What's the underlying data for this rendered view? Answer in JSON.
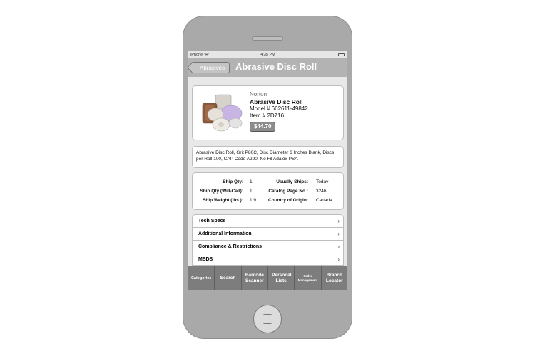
{
  "status_bar": {
    "carrier": "iPhone",
    "time": "4:35 PM"
  },
  "nav": {
    "back_label": "Abrasives",
    "title": "Abrasive Disc Roll"
  },
  "product": {
    "brand": "Norton",
    "name": "Abrasive Disc Roll",
    "model": "Model # 662611-49842",
    "item": "Item # 2D716",
    "price": "$44.70"
  },
  "description": "Abrasive Disc Roll, Grit P80C, Disc Diameter 6 Inches Blank, Discs per Roll 100, CAP Code A290, No Fil Adalox PSA",
  "shipping": {
    "rows": [
      {
        "label1": "Ship Qty:",
        "value1": "1",
        "label2": "Usually Ships:",
        "value2": "Today"
      },
      {
        "label1": "Ship Qty (Will-Call):",
        "value1": "1",
        "label2": "Catalog Page No.:",
        "value2": "3246"
      },
      {
        "label1": "Ship Weight (lbs.):",
        "value1": "1.9",
        "label2": "Country of Origin:",
        "value2": "Canada"
      }
    ]
  },
  "sections": [
    {
      "label": "Tech Specs"
    },
    {
      "label": "Additional Information"
    },
    {
      "label": "Compliance & Restrictions"
    },
    {
      "label": "MSDS"
    }
  ],
  "tabs": {
    "categories": "Categories",
    "search": "Search",
    "barcode_scanner": "Barcode Scanner",
    "personal_lists": "Personal Lists",
    "order_management": "Order Management",
    "branch_locator": "Branch Locator"
  },
  "chevron_glyph": "›",
  "icons": [
    "wifi-icon",
    "battery-icon",
    "chevron-right-icon",
    "home-button-icon"
  ]
}
